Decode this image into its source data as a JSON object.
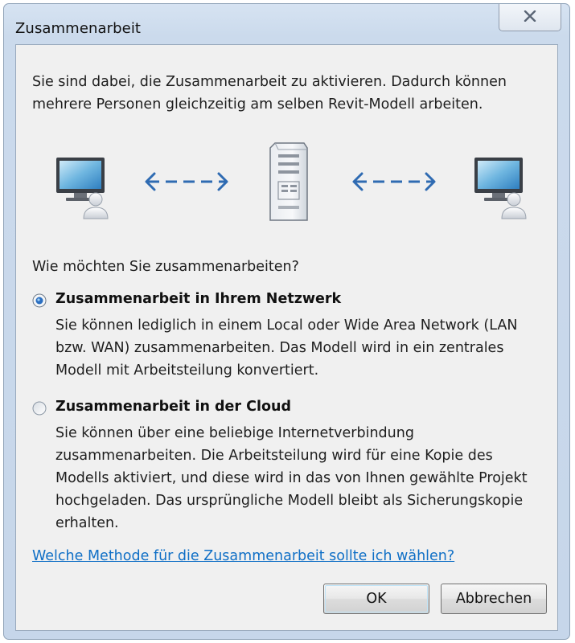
{
  "window": {
    "title": "Zusammenarbeit",
    "close_icon": "close-icon"
  },
  "intro_text": "Sie sind dabei, die Zusammenarbeit zu aktivieren. Dadurch können mehrere Personen gleichzeitig am selben Revit-Modell arbeiten.",
  "diagram": {
    "icons": [
      "computer-user-icon",
      "double-arrow-icon",
      "server-icon",
      "double-arrow-icon",
      "computer-user-icon"
    ]
  },
  "question": "Wie möchten Sie zusammenarbeiten?",
  "options": [
    {
      "title": "Zusammenarbeit in Ihrem Netzwerk",
      "description": "Sie können lediglich in einem Local oder Wide Area Network (LAN bzw. WAN) zusammenarbeiten. Das Modell wird in ein zentrales Modell mit Arbeitsteilung konvertiert.",
      "selected": true
    },
    {
      "title": "Zusammenarbeit in der Cloud",
      "description": "Sie können über eine beliebige Internetverbindung zusammenarbeiten. Die Arbeitsteilung wird für eine Kopie des Modells aktiviert, und diese wird in das von Ihnen gewählte Projekt hochgeladen. Das ursprüngliche Modell bleibt als Sicherungskopie erhalten.",
      "selected": false
    }
  ],
  "help_link": "Welche Methode für die Zusammenarbeit sollte ich wählen?",
  "buttons": {
    "ok": "OK",
    "cancel": "Abbrechen"
  },
  "colors": {
    "link": "#0f6fc6",
    "arrow": "#2f6bb2",
    "radio_selected": "#2b6fc1"
  }
}
